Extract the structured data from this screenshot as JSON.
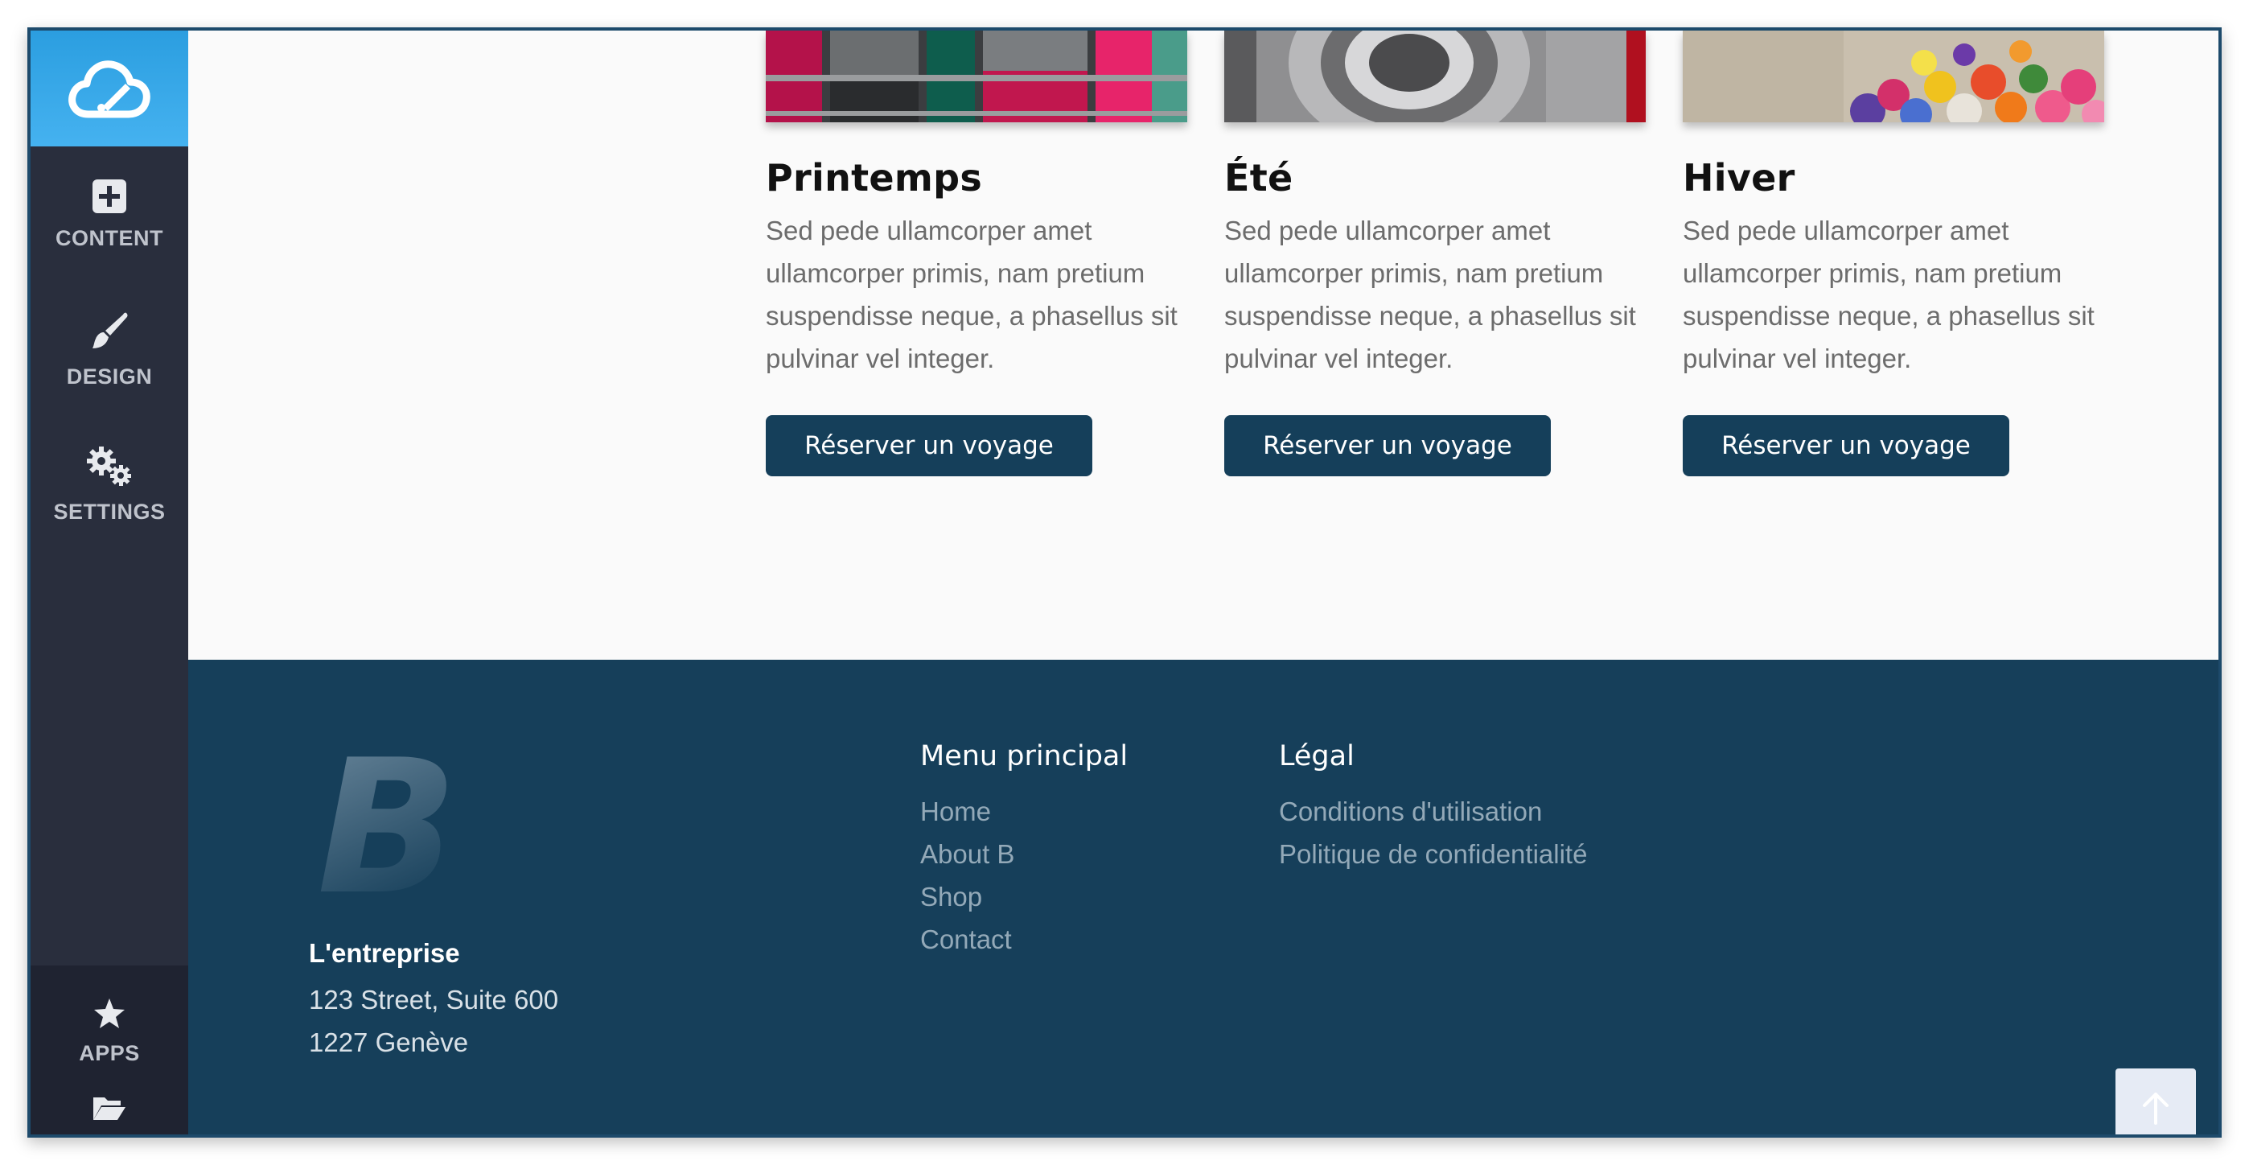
{
  "sidebar": {
    "logo_icon": "cloud-brush-icon",
    "items": [
      {
        "label": "CONTENT",
        "icon": "plus-square-icon"
      },
      {
        "label": "DESIGN",
        "icon": "paintbrush-icon"
      },
      {
        "label": "SETTINGS",
        "icon": "gears-icon"
      }
    ],
    "bottom_items": [
      {
        "label": "APPS",
        "icon": "star-icon"
      }
    ],
    "folder_icon": "folder-open-icon"
  },
  "cards": [
    {
      "title": "Printemps",
      "text": "Sed pede ullamcorper amet ullamcorper primis, nam pretium suspendisse neque, a phasellus sit pulvinar vel integer.",
      "button": "Réserver un voyage"
    },
    {
      "title": "Été",
      "text": "Sed pede ullamcorper amet ullamcorper primis, nam pretium suspendisse neque, a phasellus sit pulvinar vel integer.",
      "button": "Réserver un voyage"
    },
    {
      "title": "Hiver",
      "text": "Sed pede ullamcorper amet ullamcorper primis, nam pretium suspendisse neque, a phasellus sit pulvinar vel integer.",
      "button": "Réserver un voyage"
    }
  ],
  "footer": {
    "logo_letter": "B",
    "company": "L'entreprise",
    "address_line1": "123 Street, Suite 600",
    "address_line2": "1227 Genève",
    "menu_title": "Menu principal",
    "menu_links": [
      "Home",
      "About B",
      "Shop",
      "Contact"
    ],
    "legal_title": "Légal",
    "legal_links": [
      "Conditions d'utilisation",
      "Politique de confidentialité"
    ]
  },
  "colors": {
    "accent": "#153f5a",
    "footer_bg": "#163f5a",
    "sidebar_bg": "#292e3d",
    "logo_bg": "#3aa8ea"
  }
}
